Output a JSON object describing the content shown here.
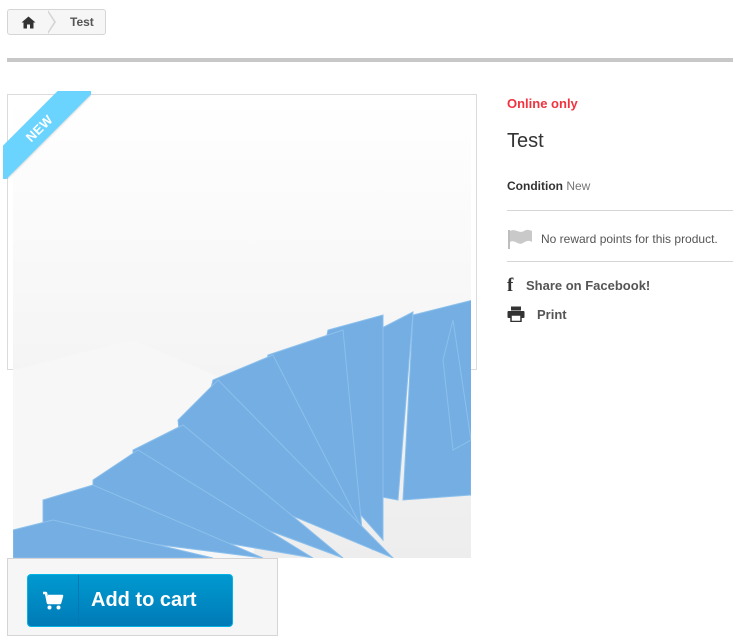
{
  "breadcrumb": {
    "home_icon": "home-icon",
    "current": "Test"
  },
  "product": {
    "badge": "NEW",
    "online_only": "Online only",
    "title": "Test",
    "condition_label": "Condition",
    "condition_value": "New",
    "reward_text": "No reward points for this product.",
    "share_facebook": "Share on Facebook!",
    "print": "Print"
  },
  "cart": {
    "add_to_cart": "Add to cart",
    "icon": "shopping-cart-icon"
  },
  "colors": {
    "online_only": "#f13340",
    "new_badge": "#6ad4ff",
    "cart_button": "#009ad0",
    "paper_blue": "#74aee3"
  }
}
